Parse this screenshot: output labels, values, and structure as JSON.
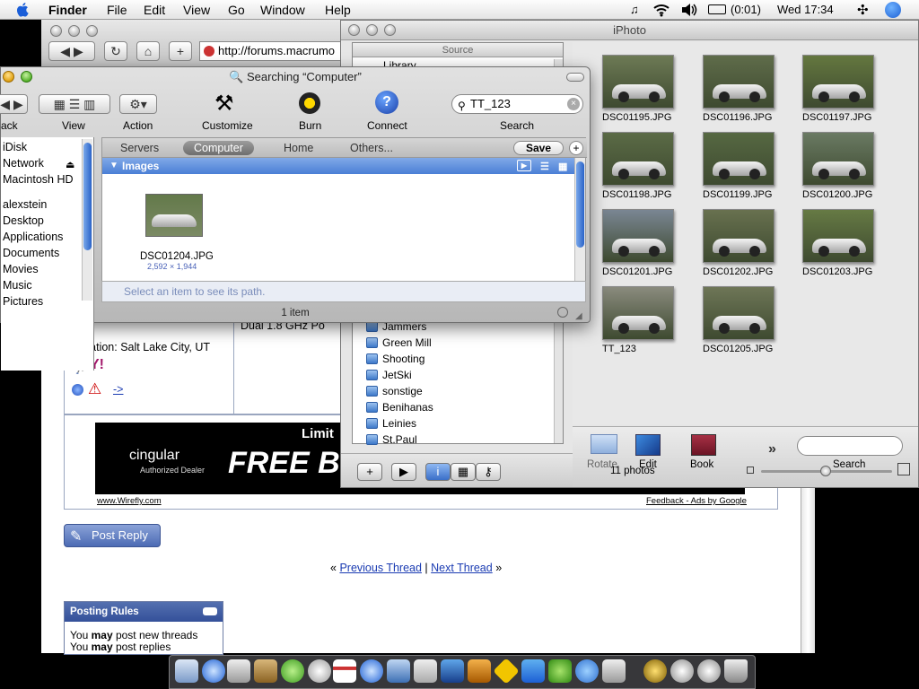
{
  "menubar": {
    "app_name": "Finder",
    "menus": [
      "File",
      "Edit",
      "View",
      "Go",
      "Window",
      "Help"
    ],
    "battery": "(0:01)",
    "clock": "Wed 17:34"
  },
  "browser": {
    "url": "http://forums.macrumo",
    "location": "Location: Salt Lake City, UT",
    "ad_brand": "cingular",
    "ad_sub": "Authorized Dealer",
    "ad_headline": "FREE BL",
    "ad_limit": "Limit",
    "ad_left_link": "www.Wirefly.com",
    "ad_right_link": "Feedback - Ads by Google",
    "post_reply": "Post Reply",
    "prev_thread": "Previous Thread",
    "next_thread": "Next Thread",
    "nav_sep": "|",
    "nav_open": "«",
    "nav_close": "»",
    "posting_rules_title": "Posting Rules",
    "rules_line1_pre": "You ",
    "rules_line1_bold": "may",
    "rules_line1_post": " post new threads",
    "rules_line2_pre": "You ",
    "rules_line2_bold": "may",
    "rules_line2_post": " post replies",
    "partial_text": "Dual 1.8 GHz Po",
    "arrow_link": "->"
  },
  "iphoto": {
    "title": "iPhoto",
    "source_header": "Source",
    "library": "Library",
    "albums": [
      "Jammers",
      "Green Mill",
      "Shooting",
      "JetSki",
      "sonstige",
      "Benihanas",
      "Leinies",
      "St.Paul"
    ],
    "photos": [
      {
        "label": "DSC01195.JPG",
        "bg": "#6d7a55"
      },
      {
        "label": "DSC01196.JPG",
        "bg": "#5f6c4a"
      },
      {
        "label": "DSC01197.JPG",
        "bg": "#64773f"
      },
      {
        "label": "DSC01198.JPG",
        "bg": "#5b6b46"
      },
      {
        "label": "DSC01199.JPG",
        "bg": "#566842"
      },
      {
        "label": "DSC01200.JPG",
        "bg": "#6a7a63"
      },
      {
        "label": "DSC01201.JPG",
        "bg": "#7a8693"
      },
      {
        "label": "DSC01202.JPG",
        "bg": "#68714f"
      },
      {
        "label": "DSC01203.JPG",
        "bg": "#667a44"
      },
      {
        "label": "TT_123",
        "bg": "#8a8b7e"
      },
      {
        "label": "DSC01205.JPG",
        "bg": "#6e7657"
      }
    ],
    "tools": {
      "rotate": "Rotate",
      "edit": "Edit",
      "book": "Book",
      "more": "»",
      "search": "Search"
    },
    "count": "11 photos"
  },
  "finder": {
    "title": "Searching “Computer”",
    "toolbar": {
      "back": "ack",
      "view": "View",
      "action": "Action",
      "customize": "Customize",
      "burn": "Burn",
      "connect": "Connect",
      "search": "Search"
    },
    "search_value": "TT_123",
    "sidebar": [
      "iDisk",
      "Network",
      "Macintosh HD",
      "alexstein",
      "Desktop",
      "Applications",
      "Documents",
      "Movies",
      "Music",
      "Pictures"
    ],
    "scopes": [
      "Servers",
      "Computer",
      "Home",
      "Others..."
    ],
    "save": "Save",
    "group": "Images",
    "result_name": "DSC01204.JPG",
    "result_dims": "2,592 × 1,944",
    "path_hint": "Select an item to see its path.",
    "status": "1 item"
  }
}
